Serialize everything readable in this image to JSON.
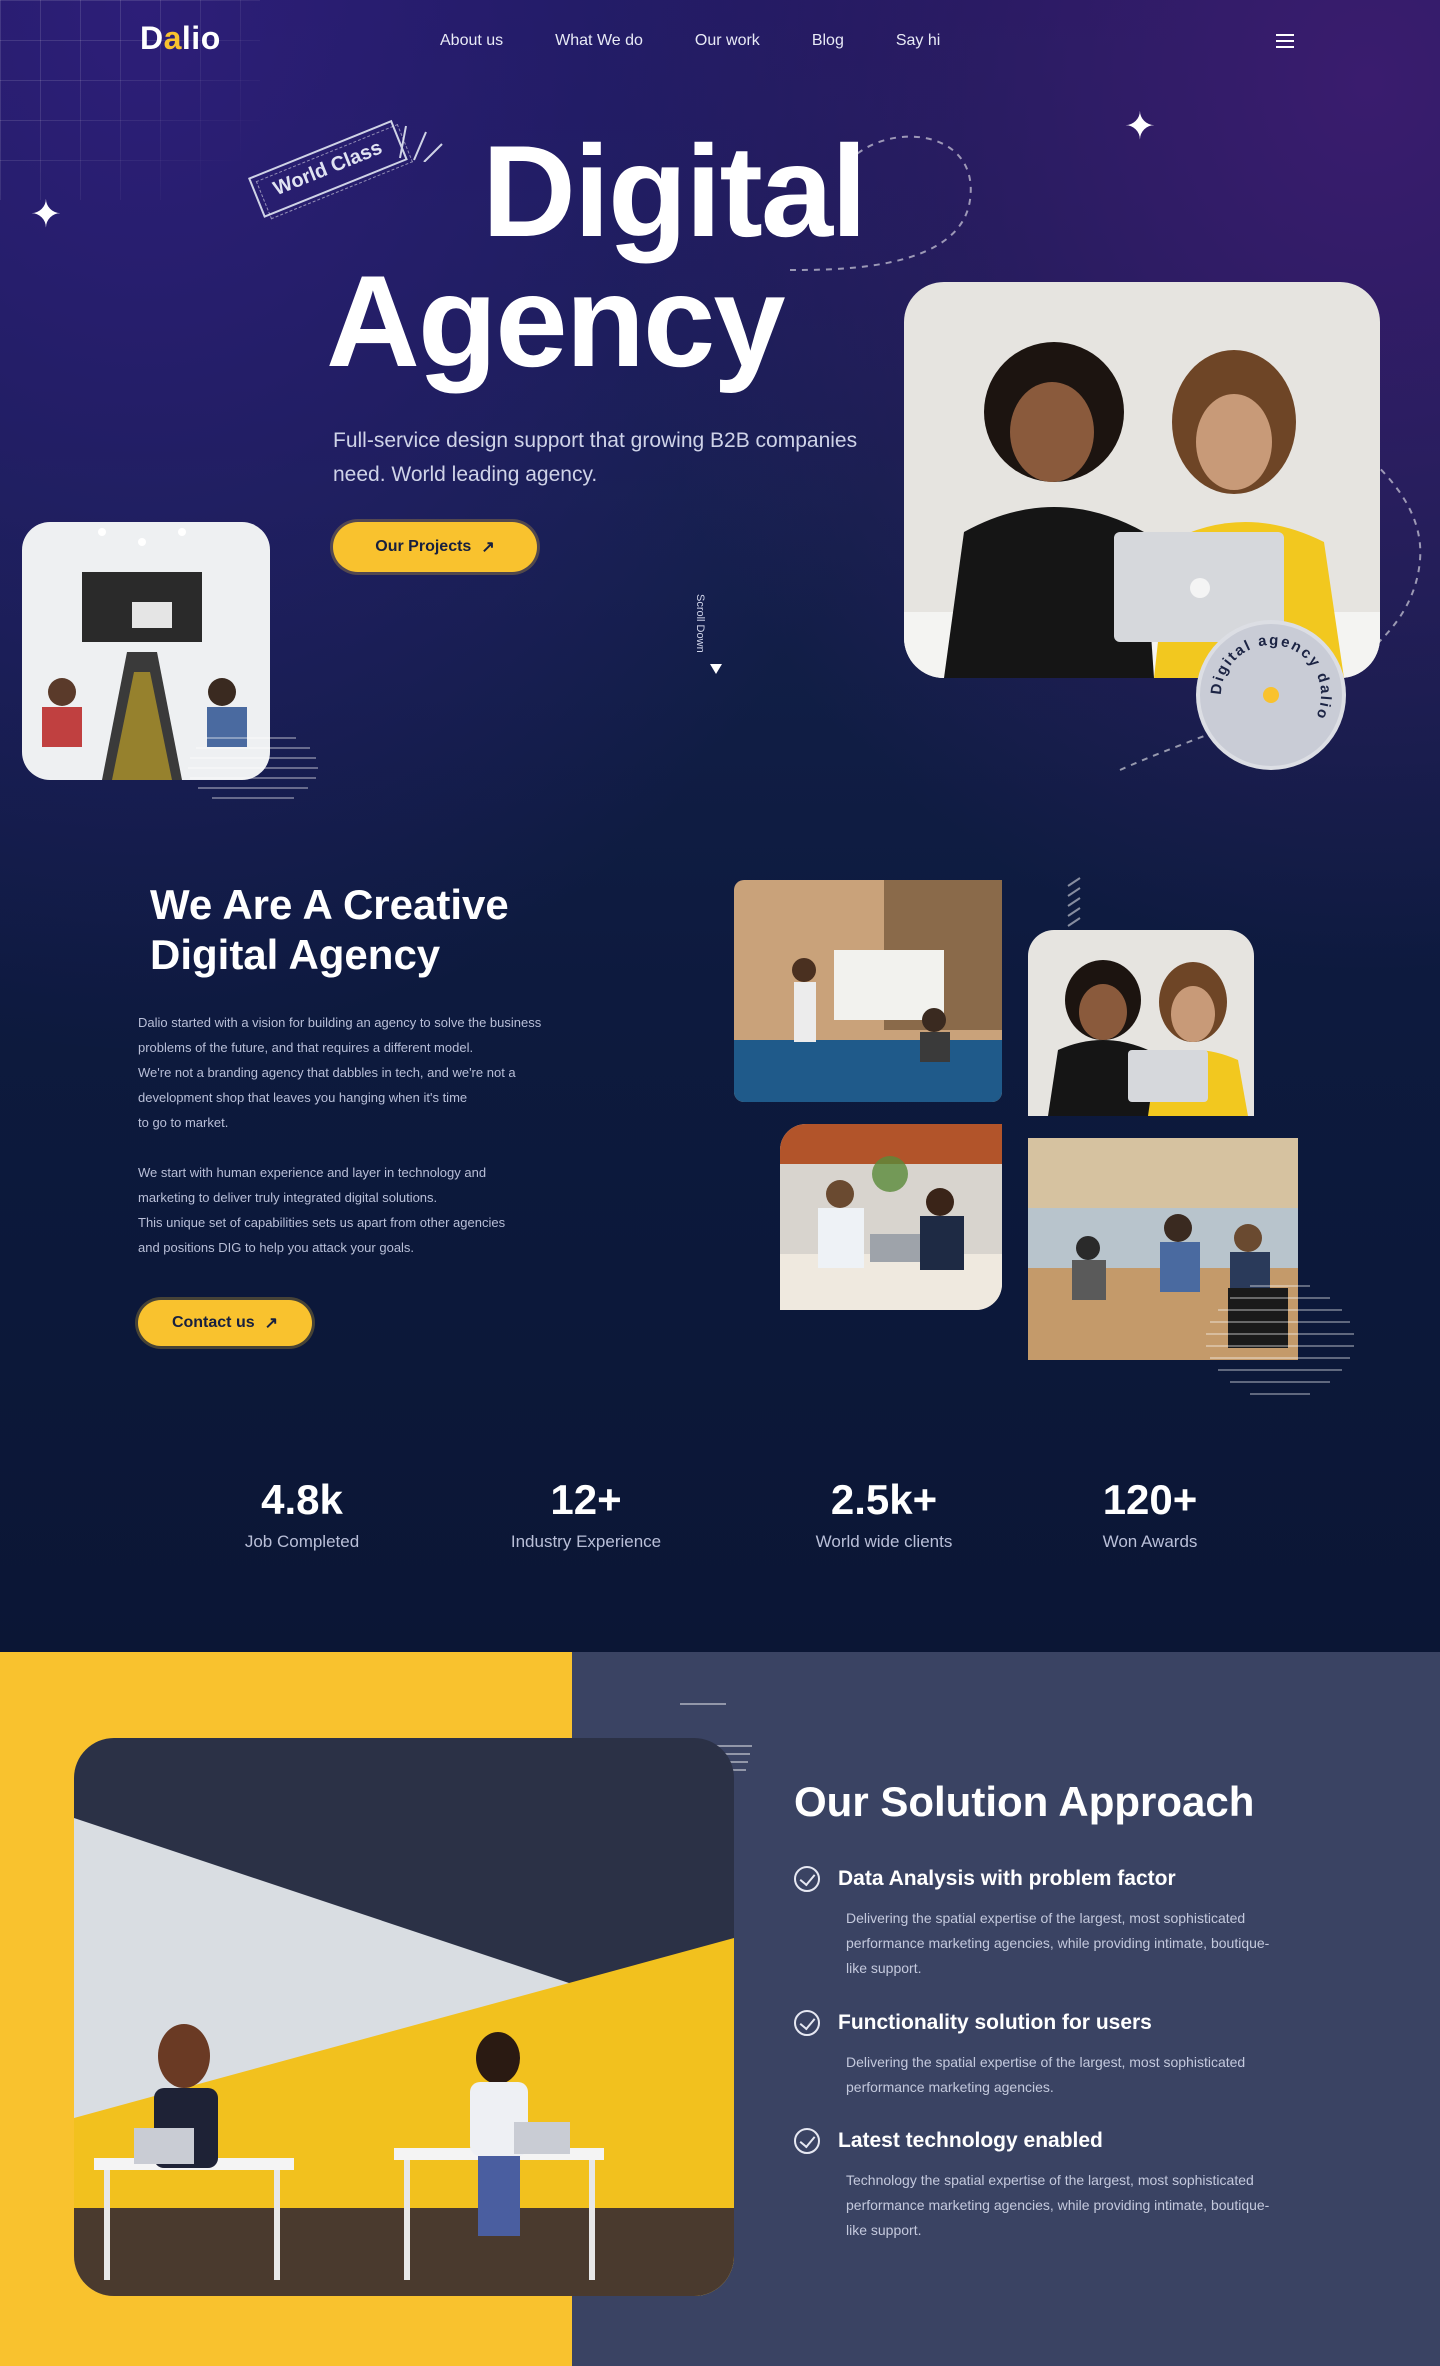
{
  "brand": {
    "logo_pre": "D",
    "logo_o": "a",
    "logo_post": "lio"
  },
  "nav": {
    "items": [
      "About us",
      "What We do",
      "Our work",
      "Blog",
      "Say hi"
    ]
  },
  "hero": {
    "badge": "World Class",
    "title_line1": "Digital",
    "title_line2": "Agency",
    "subtitle": "Full-service design support that growing B2B companies need. World leading agency.",
    "cta_label": "Our Projects",
    "cta_arrow": "↗",
    "scroll_label": "Scroll Down",
    "circle_badge": "Digital agency dalio"
  },
  "about": {
    "title_line1": "We Are A Creative",
    "title_line2": "Digital Agency",
    "p1_lines": [
      "Dalio started with a vision for building an agency to solve the business",
      "problems of the future, and that requires a different model.",
      "We're not a branding agency that dabbles in tech, and we're not a",
      "development shop that leaves you hanging when it's time",
      "to go to market."
    ],
    "p2_lines": [
      "We start with human experience and layer in technology and",
      "marketing to deliver truly integrated digital solutions.",
      "This unique set of capabilities sets us apart from other agencies",
      "and positions DIG to help you attack your goals."
    ],
    "cta_label": "Contact us",
    "cta_arrow": "↗"
  },
  "stats": [
    {
      "num": "4.8k",
      "label": "Job Completed"
    },
    {
      "num": "12+",
      "label": "Industry Experience"
    },
    {
      "num": "2.5k+",
      "label": "World wide clients"
    },
    {
      "num": "120+",
      "label": "Won Awards"
    }
  ],
  "solution": {
    "title": "Our Solution Approach",
    "items": [
      {
        "title": "Data Analysis with problem factor",
        "desc": "Delivering the spatial expertise of the largest, most sophisticated performance marketing agencies, while providing intimate, boutique-like support."
      },
      {
        "title": "Functionality solution for users",
        "desc": "Delivering the spatial expertise of the largest, most sophisticated performance marketing agencies."
      },
      {
        "title": "Latest technology enabled",
        "desc": "Technology the spatial expertise of the largest, most sophisticated performance marketing agencies, while providing intimate, boutique-like support."
      }
    ]
  },
  "colors": {
    "accent": "#f9c22e",
    "bg_dark": "#0d1636",
    "panel": "#3a4363"
  },
  "icons": [
    "menu-icon",
    "star-icon",
    "arrow-up-right-icon",
    "check-circle-icon",
    "scroll-arrow-icon"
  ]
}
